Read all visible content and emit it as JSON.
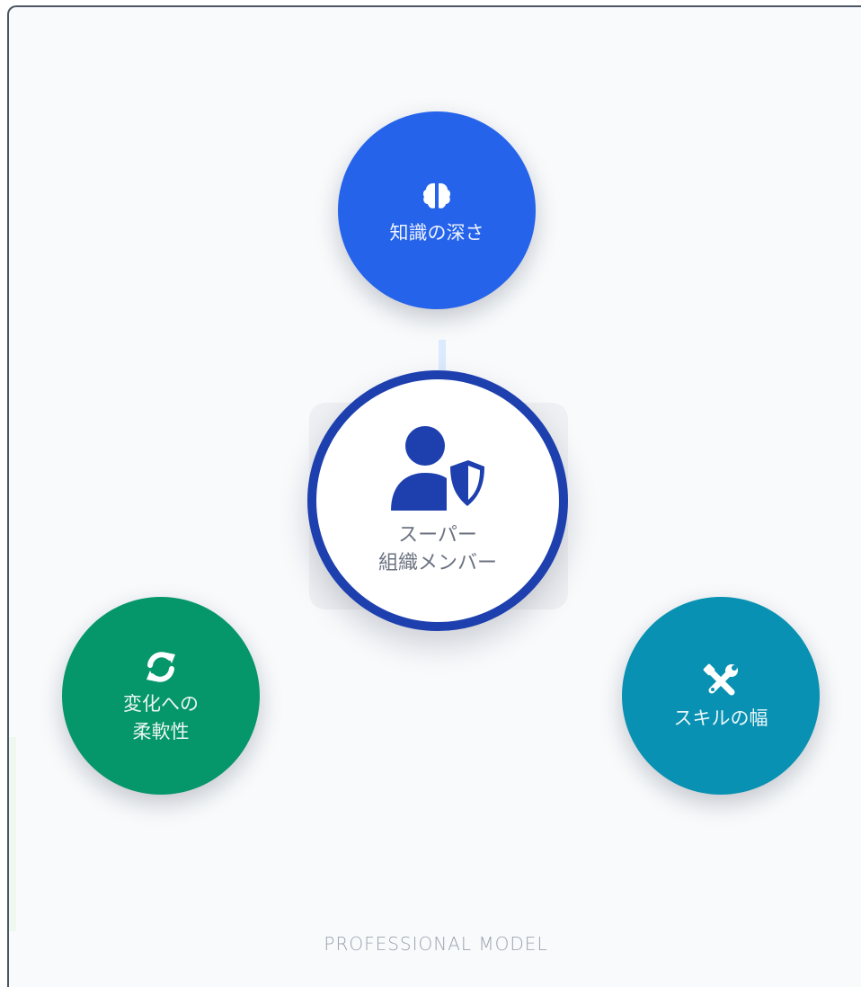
{
  "nodes": {
    "top": {
      "label": "知識の深さ",
      "icon": "brain-icon",
      "color": "#2563eb"
    },
    "left": {
      "label": "変化への\n柔軟性",
      "icon": "refresh-icon",
      "color": "#059669"
    },
    "right": {
      "label": "スキルの幅",
      "icon": "tools-icon",
      "color": "#0891b2"
    }
  },
  "center": {
    "label": "スーパー\n組織メンバー",
    "icon": "user-shield-icon",
    "ring_color": "#1e40af"
  },
  "footer": {
    "text": "PROFESSIONAL MODEL"
  }
}
